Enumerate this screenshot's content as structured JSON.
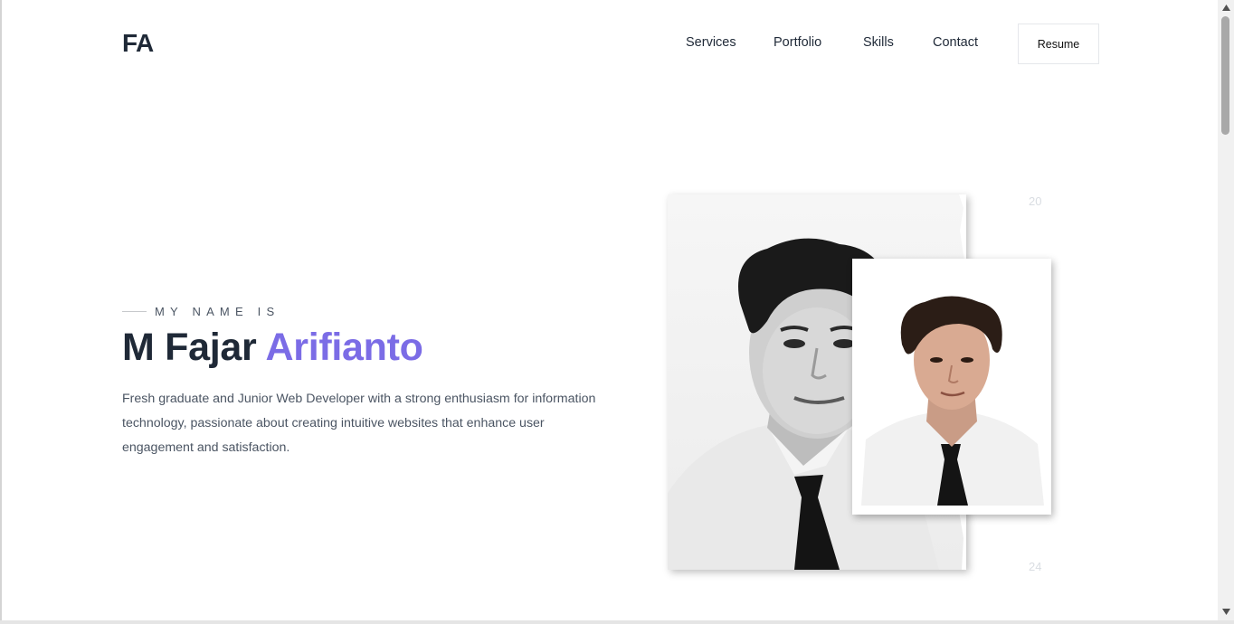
{
  "header": {
    "logo": "FA",
    "nav": [
      {
        "label": "Services"
      },
      {
        "label": "Portfolio"
      },
      {
        "label": "Skills"
      },
      {
        "label": "Contact"
      }
    ],
    "resume_label": "Resume"
  },
  "hero": {
    "kicker": "MY NAME IS",
    "name_first": "M Fajar",
    "name_accent": "Arifianto",
    "bio": "Fresh graduate and Junior Web Developer with a strong enthusiasm for information technology, passionate about creating intuitive websites that enhance user engagement and satisfaction.",
    "year_top": "20",
    "year_bottom": "24"
  },
  "colors": {
    "accent": "#7b6ce6",
    "text_dark": "#1f2937",
    "text_muted": "#4b5563"
  },
  "icons": {
    "scroll_up": "triangle-up-icon",
    "scroll_down": "triangle-down-icon"
  }
}
